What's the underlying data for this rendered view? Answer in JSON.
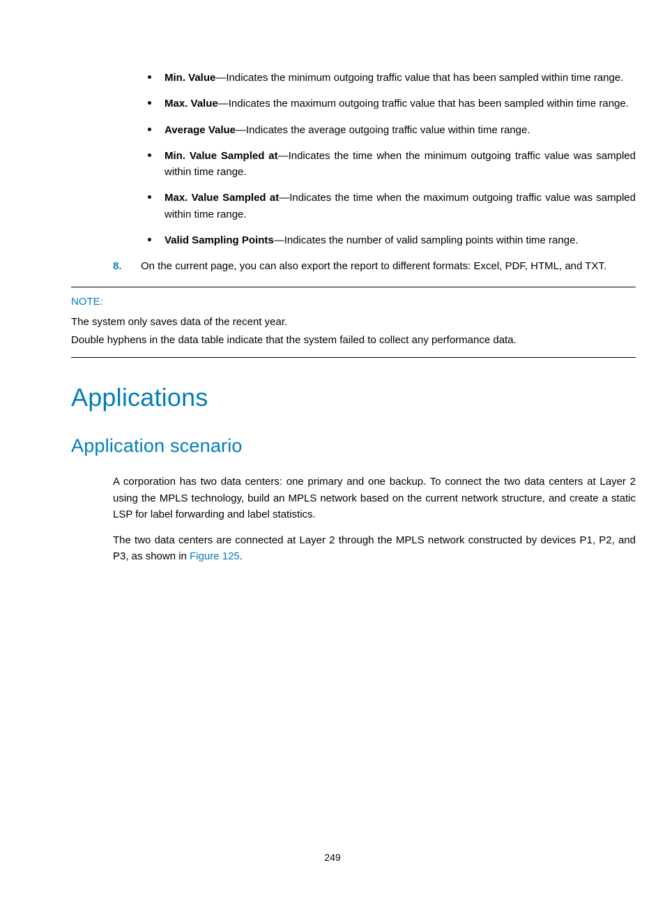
{
  "bullets": [
    {
      "term": "Min. Value",
      "text": "—Indicates the minimum outgoing traffic value that has been sampled within time range."
    },
    {
      "term": "Max. Value",
      "text": "—Indicates the maximum outgoing traffic value that has been sampled within time range."
    },
    {
      "term": "Average Value",
      "text": "—Indicates the average outgoing traffic value within time range."
    },
    {
      "term": "Min. Value Sampled at",
      "text": "—Indicates the time when the minimum outgoing traffic value was sampled within time range."
    },
    {
      "term": "Max. Value Sampled at",
      "text": "—Indicates the time when the maximum outgoing traffic value was sampled within time range."
    },
    {
      "term": "Valid Sampling Points",
      "text": "—Indicates the number of valid sampling points within time range."
    }
  ],
  "numbered": {
    "marker": "8.",
    "text": "On the current page, you can also export the report to different formats: Excel, PDF, HTML, and TXT."
  },
  "note": {
    "label": "NOTE:",
    "lines": [
      "The system only saves data of the recent year.",
      "Double hyphens in the data table indicate that the system failed to collect any performance data."
    ]
  },
  "h1": "Applications",
  "h2": "Application scenario",
  "para1": "A corporation has two data centers: one primary and one backup. To connect the two data centers at Layer 2 using the MPLS technology, build an MPLS network based on the current network structure, and create a static LSP for label forwarding and label statistics.",
  "para2_pre": "The two data centers are connected at Layer 2 through the MPLS network constructed by devices P1, P2, and P3, as shown in ",
  "para2_link": "Figure 125",
  "para2_post": ".",
  "page_number": "249"
}
